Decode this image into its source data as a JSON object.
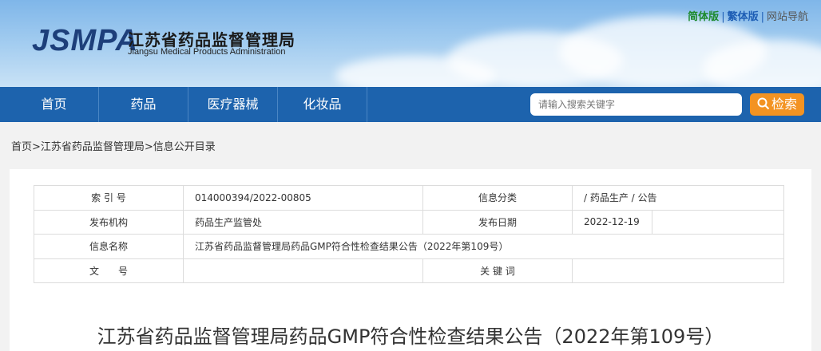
{
  "header": {
    "logo_mark": "JSMPA",
    "org_cn": "江苏省药品监督管理局",
    "org_en": "Jiangsu Medical Products Administration",
    "links": [
      "简体版",
      "繁体版",
      "网站导航"
    ],
    "link_sep": "|"
  },
  "nav": {
    "items": [
      "首页",
      "药品",
      "医疗器械",
      "化妆品"
    ],
    "search_placeholder": "请输入搜索关键字",
    "search_label": "检索"
  },
  "breadcrumb": "首页>江苏省药品监督管理局>信息公开目录",
  "meta": {
    "index_label": "索 引 号",
    "index_value": "014000394/2022-00805",
    "category_label": "信息分类",
    "category_value": "/  药品生产  /  公告",
    "publisher_label": "发布机构",
    "publisher_value": "药品生产监管处",
    "date_label": "发布日期",
    "date_value": "2022-12-19",
    "name_label": "信息名称",
    "name_value": "江苏省药品监督管理局药品GMP符合性检查结果公告（2022年第109号）",
    "docno_label": "文　　号",
    "docno_value": "",
    "keywords_label": "关 键 词",
    "keywords_value": ""
  },
  "article_title": "江苏省药品监督管理局药品GMP符合性检查结果公告（2022年第109号）",
  "colors": {
    "nav": "#1d63ad",
    "search_button": "#f39322",
    "logo": "#1d3f7a"
  }
}
